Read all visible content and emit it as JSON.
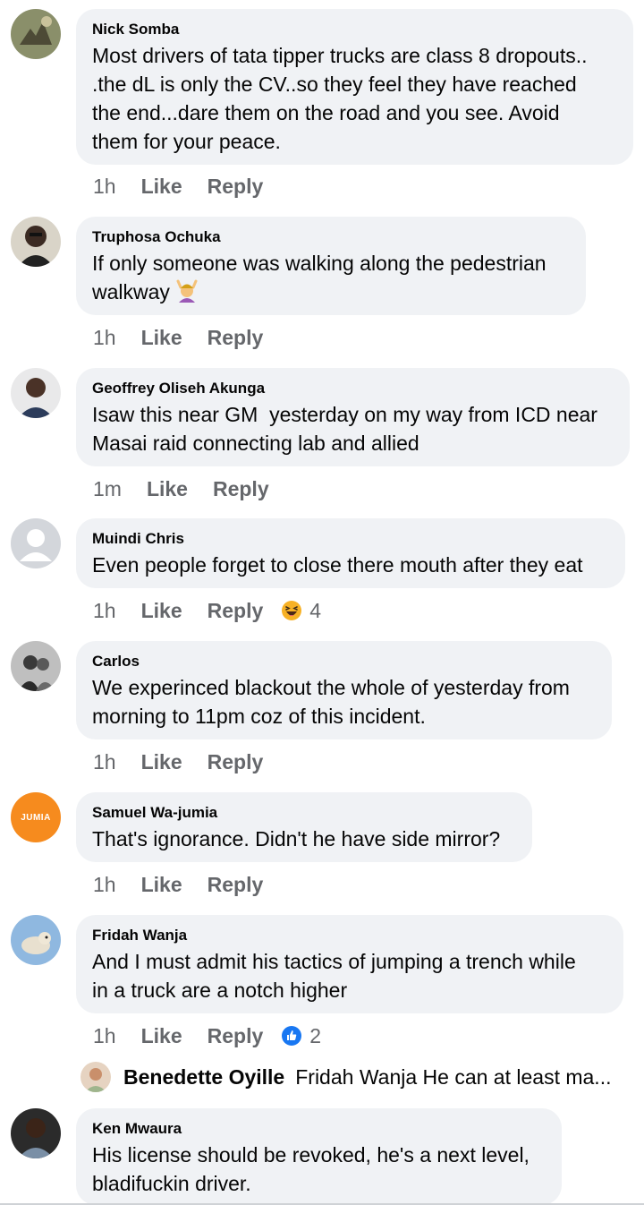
{
  "comments": [
    {
      "author": "Nick Somba",
      "lines": [
        "Most drivers of tata tipper trucks are class 8 dropouts..",
        ".the dL is only the CV..so they feel they have reached",
        "the end...dare them on the road and you see. Avoid",
        "them for your peace."
      ],
      "time": "1h",
      "like": "Like",
      "reply": "Reply"
    },
    {
      "author": "Truphosa Ochuka",
      "lines": [
        "If only someone was walking along the pedestrian",
        "walkway"
      ],
      "emoji": "raising-hands-person-emoji",
      "time": "1h",
      "like": "Like",
      "reply": "Reply"
    },
    {
      "author": "Geoffrey Oliseh Akunga",
      "lines": [
        "Isaw this near GM  yesterday on my way from ICD near",
        "Masai raid connecting lab and allied"
      ],
      "time": "1m",
      "like": "Like",
      "reply": "Reply"
    },
    {
      "author": "Muindi Chris",
      "lines": [
        "Even people forget to close there mouth after they eat"
      ],
      "time": "1h",
      "like": "Like",
      "reply": "Reply",
      "reaction": {
        "icon": "haha-reaction-icon",
        "count": "4"
      }
    },
    {
      "author": "Carlos",
      "lines": [
        "We experinced blackout the whole of yesterday from",
        "morning to 11pm coz of this incident."
      ],
      "time": "1h",
      "like": "Like",
      "reply": "Reply"
    },
    {
      "author": "Samuel Wa-jumia",
      "avatar_text": "JUMIA",
      "lines": [
        "That's ignorance. Didn't he have side mirror?"
      ],
      "time": "1h",
      "like": "Like",
      "reply": "Reply"
    },
    {
      "author": "Fridah Wanja",
      "lines": [
        "And I must admit his tactics of jumping a trench while",
        "in a truck are a notch higher"
      ],
      "time": "1h",
      "like": "Like",
      "reply": "Reply",
      "reaction": {
        "icon": "like-reaction-icon",
        "count": "2"
      }
    },
    {
      "author": "Ken Mwaura",
      "lines": [
        "His license should be revoked, he's a next level,",
        "bladifuckin driver."
      ]
    }
  ],
  "reply_preview": {
    "author": "Benedette Oyille",
    "text": "Fridah Wanja He can at least ma..."
  },
  "colors": {
    "bubble": "#f0f2f5",
    "meta_text": "#65676b",
    "like_blue": "#1877f2",
    "jumia_orange": "#f68b1e"
  }
}
